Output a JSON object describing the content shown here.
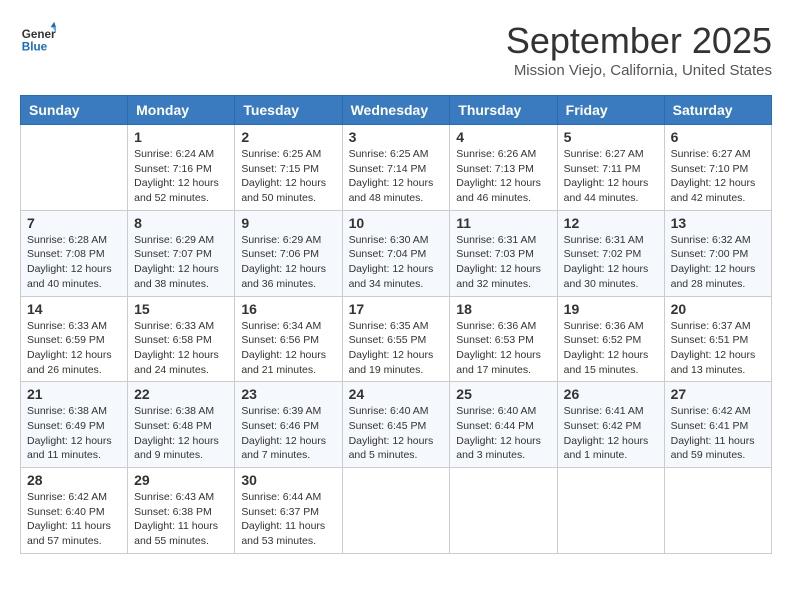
{
  "header": {
    "logo_general": "General",
    "logo_blue": "Blue",
    "month": "September 2025",
    "location": "Mission Viejo, California, United States"
  },
  "weekdays": [
    "Sunday",
    "Monday",
    "Tuesday",
    "Wednesday",
    "Thursday",
    "Friday",
    "Saturday"
  ],
  "weeks": [
    [
      {
        "day": "",
        "info": ""
      },
      {
        "day": "1",
        "info": "Sunrise: 6:24 AM\nSunset: 7:16 PM\nDaylight: 12 hours\nand 52 minutes."
      },
      {
        "day": "2",
        "info": "Sunrise: 6:25 AM\nSunset: 7:15 PM\nDaylight: 12 hours\nand 50 minutes."
      },
      {
        "day": "3",
        "info": "Sunrise: 6:25 AM\nSunset: 7:14 PM\nDaylight: 12 hours\nand 48 minutes."
      },
      {
        "day": "4",
        "info": "Sunrise: 6:26 AM\nSunset: 7:13 PM\nDaylight: 12 hours\nand 46 minutes."
      },
      {
        "day": "5",
        "info": "Sunrise: 6:27 AM\nSunset: 7:11 PM\nDaylight: 12 hours\nand 44 minutes."
      },
      {
        "day": "6",
        "info": "Sunrise: 6:27 AM\nSunset: 7:10 PM\nDaylight: 12 hours\nand 42 minutes."
      }
    ],
    [
      {
        "day": "7",
        "info": "Sunrise: 6:28 AM\nSunset: 7:08 PM\nDaylight: 12 hours\nand 40 minutes."
      },
      {
        "day": "8",
        "info": "Sunrise: 6:29 AM\nSunset: 7:07 PM\nDaylight: 12 hours\nand 38 minutes."
      },
      {
        "day": "9",
        "info": "Sunrise: 6:29 AM\nSunset: 7:06 PM\nDaylight: 12 hours\nand 36 minutes."
      },
      {
        "day": "10",
        "info": "Sunrise: 6:30 AM\nSunset: 7:04 PM\nDaylight: 12 hours\nand 34 minutes."
      },
      {
        "day": "11",
        "info": "Sunrise: 6:31 AM\nSunset: 7:03 PM\nDaylight: 12 hours\nand 32 minutes."
      },
      {
        "day": "12",
        "info": "Sunrise: 6:31 AM\nSunset: 7:02 PM\nDaylight: 12 hours\nand 30 minutes."
      },
      {
        "day": "13",
        "info": "Sunrise: 6:32 AM\nSunset: 7:00 PM\nDaylight: 12 hours\nand 28 minutes."
      }
    ],
    [
      {
        "day": "14",
        "info": "Sunrise: 6:33 AM\nSunset: 6:59 PM\nDaylight: 12 hours\nand 26 minutes."
      },
      {
        "day": "15",
        "info": "Sunrise: 6:33 AM\nSunset: 6:58 PM\nDaylight: 12 hours\nand 24 minutes."
      },
      {
        "day": "16",
        "info": "Sunrise: 6:34 AM\nSunset: 6:56 PM\nDaylight: 12 hours\nand 21 minutes."
      },
      {
        "day": "17",
        "info": "Sunrise: 6:35 AM\nSunset: 6:55 PM\nDaylight: 12 hours\nand 19 minutes."
      },
      {
        "day": "18",
        "info": "Sunrise: 6:36 AM\nSunset: 6:53 PM\nDaylight: 12 hours\nand 17 minutes."
      },
      {
        "day": "19",
        "info": "Sunrise: 6:36 AM\nSunset: 6:52 PM\nDaylight: 12 hours\nand 15 minutes."
      },
      {
        "day": "20",
        "info": "Sunrise: 6:37 AM\nSunset: 6:51 PM\nDaylight: 12 hours\nand 13 minutes."
      }
    ],
    [
      {
        "day": "21",
        "info": "Sunrise: 6:38 AM\nSunset: 6:49 PM\nDaylight: 12 hours\nand 11 minutes."
      },
      {
        "day": "22",
        "info": "Sunrise: 6:38 AM\nSunset: 6:48 PM\nDaylight: 12 hours\nand 9 minutes."
      },
      {
        "day": "23",
        "info": "Sunrise: 6:39 AM\nSunset: 6:46 PM\nDaylight: 12 hours\nand 7 minutes."
      },
      {
        "day": "24",
        "info": "Sunrise: 6:40 AM\nSunset: 6:45 PM\nDaylight: 12 hours\nand 5 minutes."
      },
      {
        "day": "25",
        "info": "Sunrise: 6:40 AM\nSunset: 6:44 PM\nDaylight: 12 hours\nand 3 minutes."
      },
      {
        "day": "26",
        "info": "Sunrise: 6:41 AM\nSunset: 6:42 PM\nDaylight: 12 hours\nand 1 minute."
      },
      {
        "day": "27",
        "info": "Sunrise: 6:42 AM\nSunset: 6:41 PM\nDaylight: 11 hours\nand 59 minutes."
      }
    ],
    [
      {
        "day": "28",
        "info": "Sunrise: 6:42 AM\nSunset: 6:40 PM\nDaylight: 11 hours\nand 57 minutes."
      },
      {
        "day": "29",
        "info": "Sunrise: 6:43 AM\nSunset: 6:38 PM\nDaylight: 11 hours\nand 55 minutes."
      },
      {
        "day": "30",
        "info": "Sunrise: 6:44 AM\nSunset: 6:37 PM\nDaylight: 11 hours\nand 53 minutes."
      },
      {
        "day": "",
        "info": ""
      },
      {
        "day": "",
        "info": ""
      },
      {
        "day": "",
        "info": ""
      },
      {
        "day": "",
        "info": ""
      }
    ]
  ]
}
